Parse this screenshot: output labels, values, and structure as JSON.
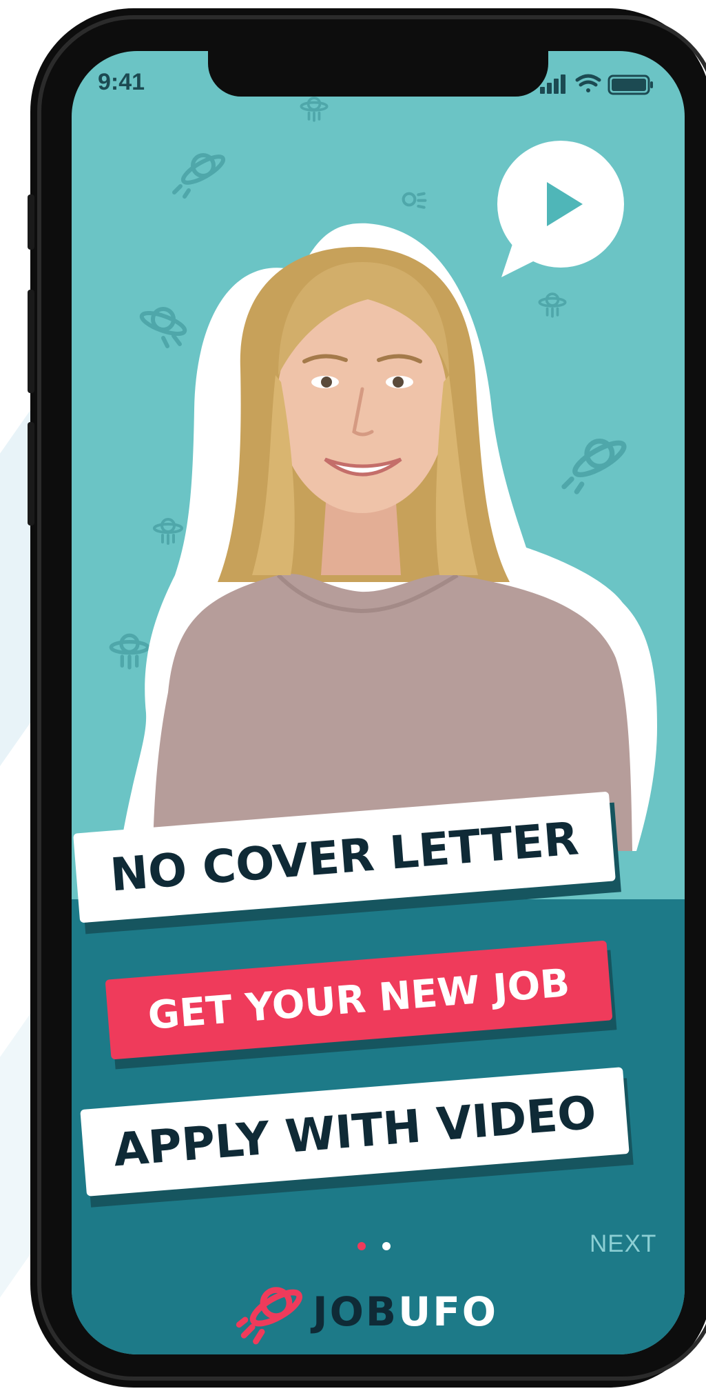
{
  "status_bar": {
    "time": "9:41"
  },
  "video": {
    "icon": "play-icon"
  },
  "banners": {
    "line1": "NO COVER LETTER",
    "line2": "GET YOUR NEW JOB",
    "line3": "APPLY WITH VIDEO"
  },
  "pager": {
    "total": 2,
    "active": 1
  },
  "nav": {
    "next_label": "NEXT"
  },
  "brand": {
    "logo_part1": "JOB",
    "logo_part2": "UFO"
  },
  "colors": {
    "screen_bg": "#6bc4c5",
    "band": "#1d7a88",
    "accent": "#ef3b5b",
    "dark_text": "#0f2a36",
    "white": "#ffffff"
  }
}
